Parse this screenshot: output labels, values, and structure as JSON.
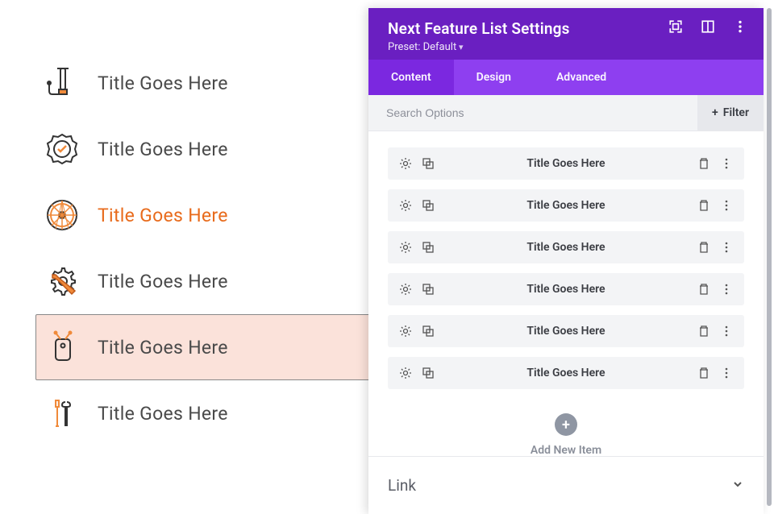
{
  "preview": {
    "items": [
      {
        "label": "Title Goes Here",
        "icon": "pump-icon",
        "active": false,
        "selected": false
      },
      {
        "label": "Title Goes Here",
        "icon": "badge-check-icon",
        "active": false,
        "selected": false
      },
      {
        "label": "Title Goes Here",
        "icon": "wheel-icon",
        "active": true,
        "selected": false
      },
      {
        "label": "Title Goes Here",
        "icon": "gear-wrench-icon",
        "active": false,
        "selected": false
      },
      {
        "label": "Title Goes Here",
        "icon": "gift-tag-icon",
        "active": false,
        "selected": true
      },
      {
        "label": "Title Goes Here",
        "icon": "tools-icon",
        "active": false,
        "selected": false
      }
    ]
  },
  "panel": {
    "title": "Next Feature List Settings",
    "preset_label": "Preset: Default",
    "tabs": [
      {
        "label": "Content",
        "active": true
      },
      {
        "label": "Design",
        "active": false
      },
      {
        "label": "Advanced",
        "active": false
      }
    ],
    "search_placeholder": "Search Options",
    "filter_label": "Filter",
    "rows": [
      {
        "title": "Title Goes Here"
      },
      {
        "title": "Title Goes Here"
      },
      {
        "title": "Title Goes Here"
      },
      {
        "title": "Title Goes Here"
      },
      {
        "title": "Title Goes Here"
      },
      {
        "title": "Title Goes Here"
      }
    ],
    "add_label": "Add New Item",
    "link_section_title": "Link"
  }
}
